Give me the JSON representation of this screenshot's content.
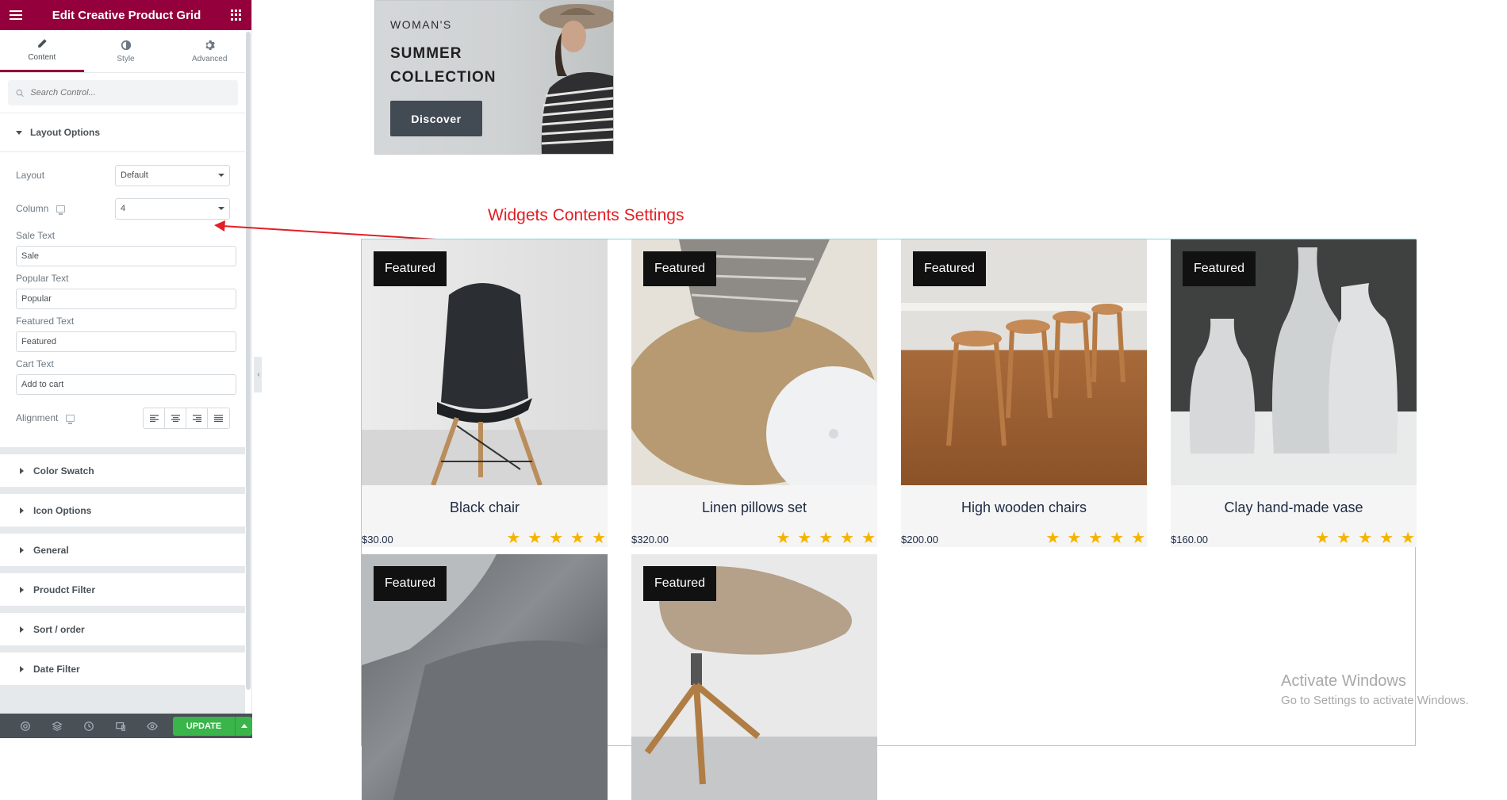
{
  "panel": {
    "title": "Edit Creative Product Grid",
    "tabs": [
      {
        "label": "Content",
        "icon": "pencil-icon"
      },
      {
        "label": "Style",
        "icon": "contrast-icon"
      },
      {
        "label": "Advanced",
        "icon": "gear-icon"
      }
    ],
    "search_placeholder": "Search Control...",
    "layout_section": {
      "title": "Layout Options",
      "layout_label": "Layout",
      "layout_value": "Default",
      "column_label": "Column",
      "column_value": "4",
      "sale_label": "Sale Text",
      "sale_value": "Sale",
      "popular_label": "Popular Text",
      "popular_value": "Popular",
      "featured_label": "Featured Text",
      "featured_value": "Featured",
      "cart_label": "Cart Text",
      "cart_value": "Add to cart",
      "alignment_label": "Alignment"
    },
    "sections": [
      {
        "title": "Color Swatch"
      },
      {
        "title": "Icon Options"
      },
      {
        "title": "General"
      },
      {
        "title": "Proudct Filter"
      },
      {
        "title": "Sort / order"
      },
      {
        "title": "Date Filter"
      }
    ],
    "footer": {
      "update_label": "UPDATE"
    }
  },
  "banner": {
    "eyebrow": "WOMAN'S",
    "heading": "SUMMER COLLECTION",
    "button": "Discover"
  },
  "annotation": "Widgets Contents Settings",
  "products": [
    {
      "badge": "Featured",
      "name": "Black chair",
      "price": "$30.00",
      "rating": 5
    },
    {
      "badge": "Featured",
      "name": "Linen pillows set",
      "price": "$320.00",
      "rating": 5
    },
    {
      "badge": "Featured",
      "name": "High wooden chairs",
      "price": "$200.00",
      "rating": 5
    },
    {
      "badge": "Featured",
      "name": "Clay hand-made vase",
      "price": "$160.00",
      "rating": 5
    },
    {
      "badge": "Featured"
    },
    {
      "badge": "Featured"
    }
  ],
  "watermark": {
    "line1": "Activate Windows",
    "line2": "Go to Settings to activate Windows."
  },
  "colors": {
    "brand": "#93003c",
    "update": "#39b54a",
    "star": "#f5b301",
    "annotation": "#e31e24"
  }
}
